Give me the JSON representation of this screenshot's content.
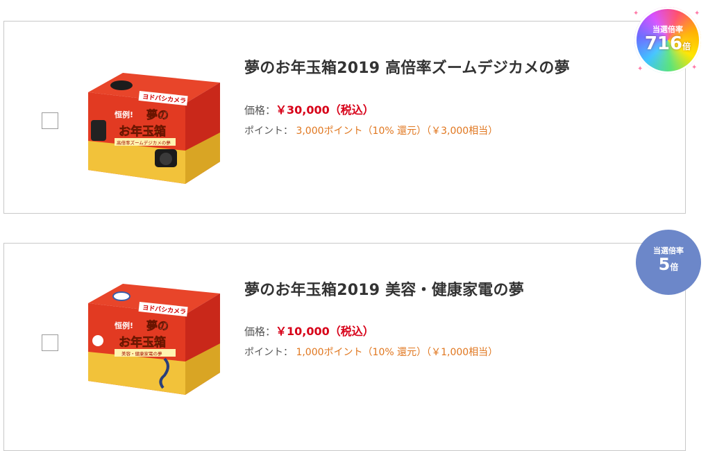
{
  "products": [
    {
      "title": "夢のお年玉箱2019 高倍率ズームデジカメの夢",
      "price_label": "価格：",
      "price": "￥30,000（税込）",
      "point_label": "ポイント：",
      "points": "3,000ポイント（10% 還元）（￥3,000相当）",
      "badge_label": "当選倍率",
      "badge_value": "716",
      "badge_unit": "倍",
      "badge_color": "rainbow",
      "image_icon": "lucky-box-image",
      "box_texts": [
        "ヨドバシカメラ",
        "恒例!",
        "夢の",
        "お年玉箱",
        "高倍率ズームデジカメの夢"
      ]
    },
    {
      "title": "夢のお年玉箱2019 美容・健康家電の夢",
      "price_label": "価格：",
      "price": "￥10,000（税込）",
      "point_label": "ポイント：",
      "points": "1,000ポイント（10% 還元）（￥1,000相当）",
      "badge_label": "当選倍率",
      "badge_value": "5",
      "badge_unit": "倍",
      "badge_color": "#6c87c9",
      "image_icon": "lucky-box-image",
      "box_texts": [
        "ヨドバシカメラ",
        "恒例!",
        "夢の",
        "お年玉箱",
        "美容・健康家電の夢"
      ]
    }
  ]
}
